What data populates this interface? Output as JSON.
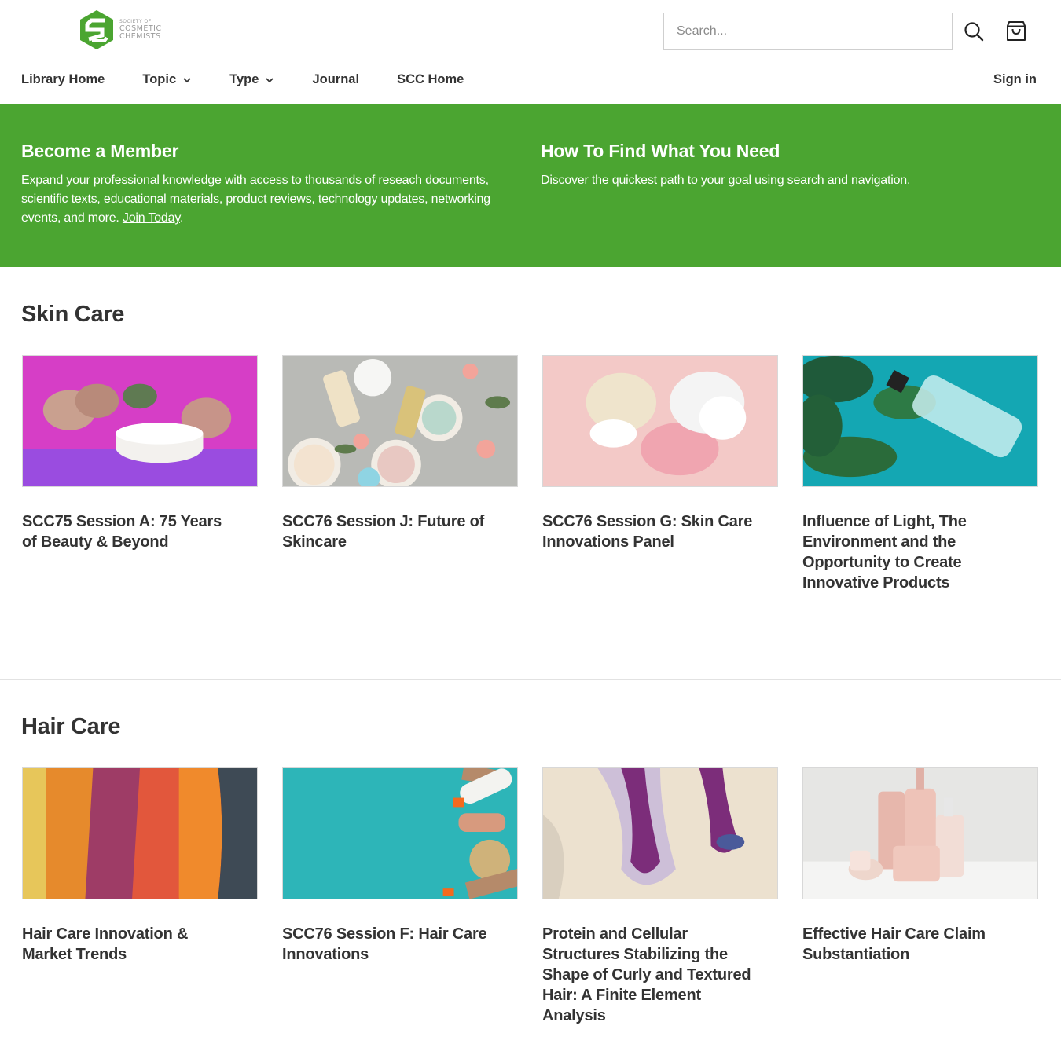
{
  "logo": {
    "line1": "SOCIETY OF",
    "line2": "COSMETIC",
    "line3": "CHEMISTS",
    "icon": "scc-logo-icon",
    "brand_color": "#4ba531"
  },
  "search": {
    "placeholder": "Search...",
    "value": "",
    "icon": "search-icon"
  },
  "cart": {
    "icon": "shopping-bag-icon"
  },
  "nav": {
    "items": [
      {
        "label": "Library Home",
        "has_dropdown": false
      },
      {
        "label": "Topic",
        "has_dropdown": true
      },
      {
        "label": "Type",
        "has_dropdown": true
      },
      {
        "label": "Journal",
        "has_dropdown": false
      },
      {
        "label": "SCC Home",
        "has_dropdown": false
      }
    ],
    "signin": "Sign in"
  },
  "banner": {
    "color": "#4ba531",
    "member": {
      "title": "Become a Member",
      "text": "Expand your professional knowledge with access to thousands of reseach documents, scientific texts, educational materials, product reviews, technology updates, networking events, and more.",
      "link": "Join Today",
      "after_link": "."
    },
    "find": {
      "title": "How To Find What You Need",
      "text": "Discover the quickest path to your goal using search and navigation."
    }
  },
  "sections": [
    {
      "title": "Skin Care",
      "cards": [
        {
          "title": "SCC75 Session A: 75 Years of Beauty & Beyond",
          "image": "cream-jar-with-flowers-image"
        },
        {
          "title": "SCC76 Session J: Future of Skincare",
          "image": "cosmetic-products-flatlay-image"
        },
        {
          "title": "SCC76 Session G: Skin Care Innovations Panel",
          "image": "cream-swatches-image"
        },
        {
          "title": "Influence of Light, The Environment and the Opportunity to Create Innovative Products",
          "image": "bottle-with-leaves-image"
        }
      ]
    },
    {
      "title": "Hair Care",
      "cards": [
        {
          "title": "Hair Care Innovation & Market Trends",
          "image": "colorful-hair-image"
        },
        {
          "title": "SCC76 Session F: Hair Care Innovations",
          "image": "hair-tools-image"
        },
        {
          "title": "Protein and Cellular Structures Stabilizing the Shape of Curly and Textured Hair: A Finite Element Analysis",
          "image": "hair-follicle-micrograph-image"
        },
        {
          "title": "Effective Hair Care Claim Substantiation",
          "image": "pink-hair-products-image"
        }
      ]
    }
  ]
}
